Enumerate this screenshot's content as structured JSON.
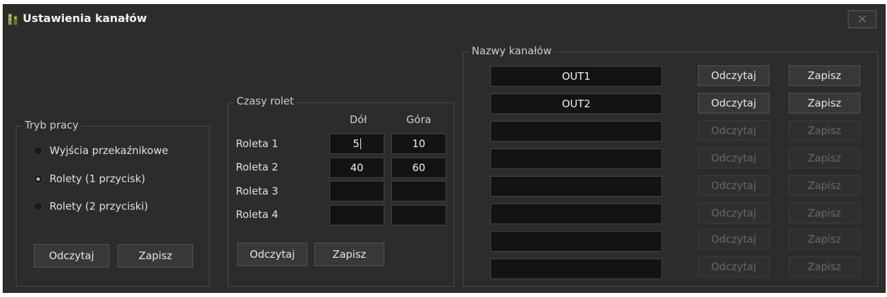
{
  "window": {
    "title": "Ustawienia kanałów",
    "close_glyph": "✕"
  },
  "mode": {
    "label": "Tryb pracy",
    "options": [
      {
        "label": "Wyjścia przekaźnikowe",
        "checked": false
      },
      {
        "label": "Rolety (1 przycisk)",
        "checked": true
      },
      {
        "label": "Rolety (2 przyciski)",
        "checked": false
      }
    ],
    "read_label": "Odczytaj",
    "save_label": "Zapisz"
  },
  "blinds": {
    "label": "Czasy rolet",
    "col_down": "Dół",
    "col_up": "Góra",
    "rows": [
      {
        "label": "Roleta 1",
        "down": "5",
        "up": "10"
      },
      {
        "label": "Roleta 2",
        "down": "40",
        "up": "60"
      },
      {
        "label": "Roleta 3",
        "down": "",
        "up": ""
      },
      {
        "label": "Roleta 4",
        "down": "",
        "up": ""
      }
    ],
    "read_label": "Odczytaj",
    "save_label": "Zapisz"
  },
  "channels": {
    "label": "Nazwy kanałów",
    "rows": [
      {
        "name": "OUT1",
        "read": "Odczytaj",
        "save": "Zapisz",
        "enabled": true
      },
      {
        "name": "OUT2",
        "read": "Odczytaj",
        "save": "Zapisz",
        "enabled": true
      },
      {
        "name": "",
        "read": "Odczytaj",
        "save": "Zapisz",
        "enabled": false
      },
      {
        "name": "",
        "read": "Odczytaj",
        "save": "Zapisz",
        "enabled": false
      },
      {
        "name": "",
        "read": "Odczytaj",
        "save": "Zapisz",
        "enabled": false
      },
      {
        "name": "",
        "read": "Odczytaj",
        "save": "Zapisz",
        "enabled": false
      },
      {
        "name": "",
        "read": "Odczytaj",
        "save": "Zapisz",
        "enabled": false
      },
      {
        "name": "",
        "read": "Odczytaj",
        "save": "Zapisz",
        "enabled": false
      }
    ]
  }
}
